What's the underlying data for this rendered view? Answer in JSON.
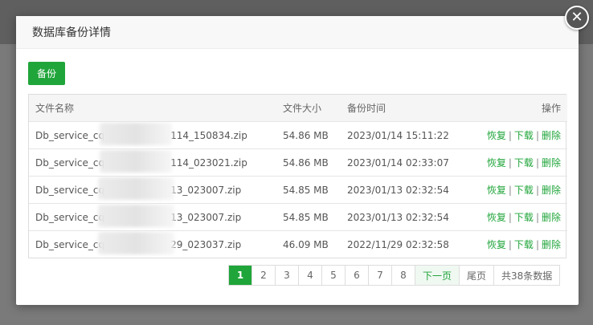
{
  "dialog": {
    "title": "数据库备份详情",
    "close_glyph": "✕"
  },
  "toolbar": {
    "backup_label": "备份"
  },
  "table": {
    "headers": {
      "filename": "文件名称",
      "size": "文件大小",
      "time": "备份时间",
      "actions": "操作"
    },
    "rows": [
      {
        "filename_prefix": "Db_service_cq",
        "filename_suffix": "114_150834.zip",
        "size": "54.86 MB",
        "time": "2023/01/14 15:11:22"
      },
      {
        "filename_prefix": "Db_service_cq",
        "filename_suffix": "114_023021.zip",
        "size": "54.86 MB",
        "time": "2023/01/14 02:33:07"
      },
      {
        "filename_prefix": "Db_service_cq",
        "filename_suffix": "13_023007.zip",
        "size": "54.85 MB",
        "time": "2023/01/13 02:32:54"
      },
      {
        "filename_prefix": "Db_service_cq",
        "filename_suffix": "13_023007.zip",
        "size": "54.85 MB",
        "time": "2023/01/13 02:32:54"
      },
      {
        "filename_prefix": "Db_service_cq",
        "filename_suffix": "29_023037.zip",
        "size": "46.09 MB",
        "time": "2022/11/29 02:32:58"
      }
    ],
    "actions": {
      "restore": "恢复",
      "download": "下载",
      "delete": "删除",
      "separator": "|"
    }
  },
  "pagination": {
    "pages": [
      "1",
      "2",
      "3",
      "4",
      "5",
      "6",
      "7",
      "8"
    ],
    "current": "1",
    "next_label": "下一页",
    "last_label": "尾页",
    "total_label": "共38条数据"
  },
  "colors": {
    "accent": "#20a53a"
  }
}
